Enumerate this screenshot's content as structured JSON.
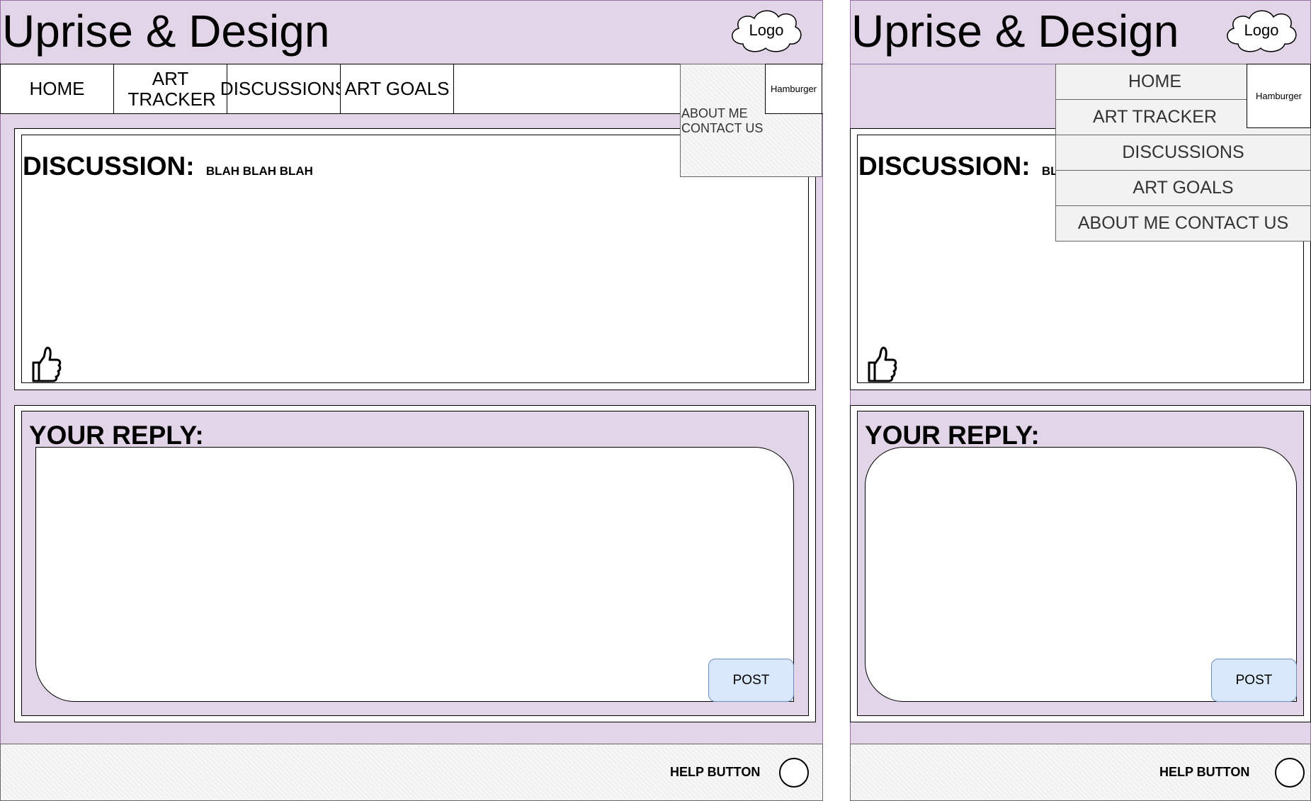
{
  "site": {
    "brand": "Uprise & Design",
    "logo": "Logo"
  },
  "nav": {
    "home": "HOME",
    "art_tracker": "ART TRACKER",
    "discussions": "DISCUSSIONS",
    "art_goals": "ART GOALS",
    "hamburger": "Hamburger",
    "about_me": "ABOUT ME",
    "contact_us": "CONTACT US"
  },
  "mobile_menu": {
    "home": "HOME",
    "art_tracker": "ART TRACKER",
    "discussions": "DISCUSSIONS",
    "art_goals": "ART GOALS",
    "about_contact": "ABOUT ME CONTACT US"
  },
  "discussion": {
    "label": "DISCUSSION:",
    "text": "BLAH BLAH BLAH",
    "mobile_text": "BLA"
  },
  "reply": {
    "label": "YOUR REPLY:",
    "post_label": "POST"
  },
  "footer": {
    "help_label": "HELP BUTTON"
  },
  "icons": {
    "like": "thumbs-up-icon",
    "logo": "cloud-logo-icon",
    "help": "help-circle-icon"
  },
  "colors": {
    "frame_bg": "#e1d5e7",
    "frame_border": "#9673a6",
    "post_bg": "#dae8fc",
    "post_border": "#6c8ebf"
  }
}
